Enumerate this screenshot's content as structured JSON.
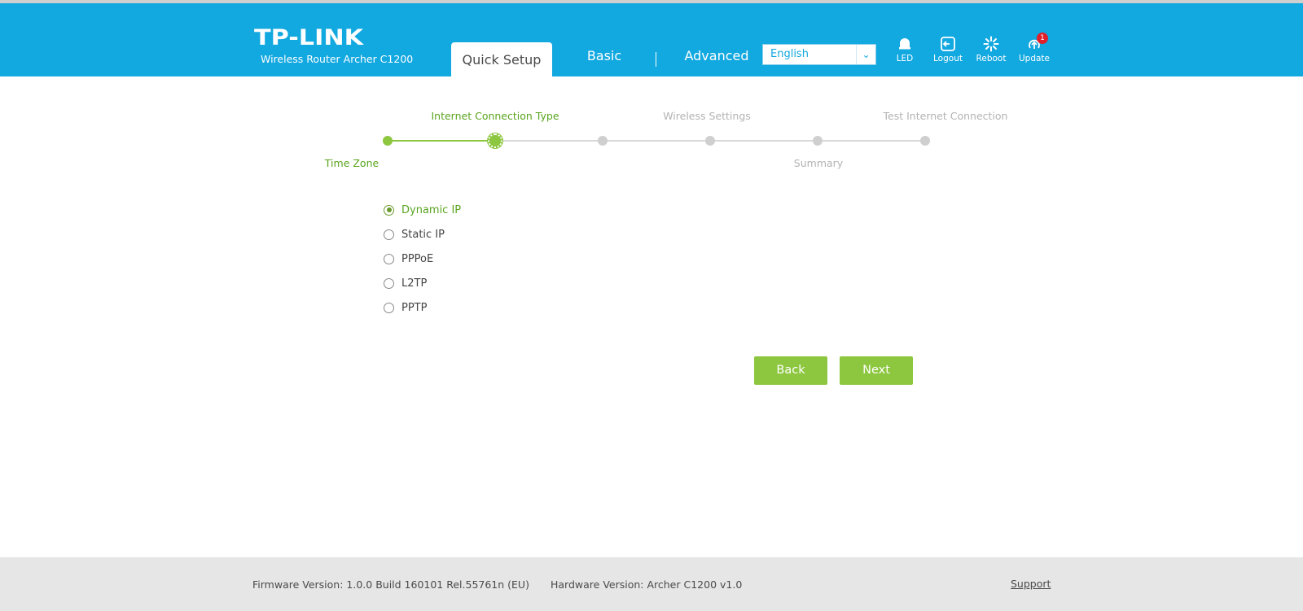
{
  "header": {
    "logo": "TP-LINK",
    "subtitle": "Wireless Router Archer C1200",
    "tabs": [
      {
        "label": "Quick Setup",
        "active": true
      },
      {
        "label": "Basic",
        "active": false
      },
      {
        "label": "Advanced",
        "active": false
      }
    ],
    "language": {
      "selected": "English"
    },
    "icons": [
      {
        "icon": "led-icon",
        "label": "LED"
      },
      {
        "icon": "logout-icon",
        "label": "Logout"
      },
      {
        "icon": "reboot-icon",
        "label": "Reboot"
      },
      {
        "icon": "update-icon",
        "label": "Update",
        "badge": "1"
      }
    ]
  },
  "wizard": {
    "steps_top": [
      "Internet Connection Type",
      "Wireless Settings",
      "Test Internet Connection"
    ],
    "steps_bottom": [
      "Time Zone",
      "Summary"
    ],
    "current_step_index": 1,
    "total_steps": 6
  },
  "connection_types": {
    "options": [
      "Dynamic IP",
      "Static IP",
      "PPPoE",
      "L2TP",
      "PPTP"
    ],
    "selected": "Dynamic IP"
  },
  "buttons": {
    "back": "Back",
    "next": "Next"
  },
  "footer": {
    "firmware": "Firmware Version: 1.0.0 Build 160101 Rel.55761n (EU)",
    "hardware": "Hardware Version: Archer C1200 v1.0",
    "support": "Support"
  },
  "colors": {
    "header": "#12a8e0",
    "accent_green": "#8dc63f",
    "footer_bg": "#e6e6e6",
    "badge": "#e0202a"
  }
}
